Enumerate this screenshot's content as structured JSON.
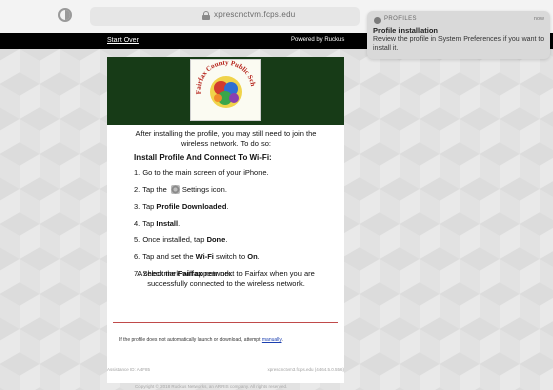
{
  "browser": {
    "url": "xprescnctvm.fcps.edu"
  },
  "notification": {
    "app": "PROFILES",
    "time": "now",
    "title": "Profile installation",
    "body": "Review the profile in System Preferences if you want to install it."
  },
  "topbar": {
    "start_over": "Start Over",
    "powered_by": "Powered by Ruckus"
  },
  "logo": {
    "text": "Fairfax County Public Schools"
  },
  "content": {
    "intro": "After installing the profile, you may still need to join the wireless network. To do so:",
    "steps_title": "Install Profile And Connect To Wi-Fi:",
    "step1": "1. Go to the main screen of your iPhone.",
    "step2_pre": "2. Tap the",
    "step2_post": "Settings icon.",
    "step3_pre": "3. Tap",
    "step3_bold": "Profile Downloaded",
    "step3_post": ".",
    "step4_pre": "4. Tap",
    "step4_bold": "Install",
    "step4_post": ".",
    "step5_pre": "5. Once installed, tap",
    "step5_bold": "Done",
    "step5_post": ".",
    "step6_pre": "6. Tap and set the",
    "step6_bold1": "Wi-Fi",
    "step6_mid": "switch to",
    "step6_bold2": "On",
    "step6_post": ".",
    "step7_pre": "7. Select the",
    "step7_bold": "Fairfax",
    "step7_post": "network.",
    "checkmark": "A checkmark will appear next to Fairfax when you are successfully connected to the wireless network.",
    "footnote_pre": "If the profile does not automatically launch or download, attempt",
    "footnote_link": "manually",
    "footnote_post": "."
  },
  "bottom": {
    "left": "Assistance ID: A4F85",
    "right": "xprescnctvm3.fcps.edu (4464.5.0.556)",
    "copyright": "Copyright © 2018 Ruckus Networks, an ARRIS company. All rights reserved."
  },
  "colors": {
    "header_green": "#173b17",
    "divider_red": "#c04a4a",
    "link_blue": "#1b3fb0"
  }
}
